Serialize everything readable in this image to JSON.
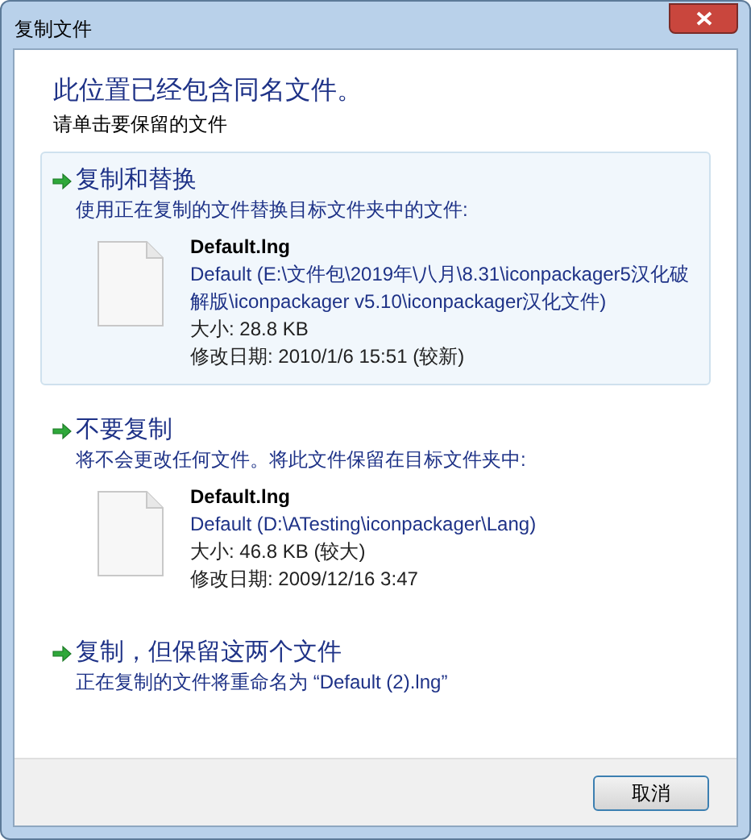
{
  "window": {
    "title": "复制文件"
  },
  "heading": "此位置已经包含同名文件。",
  "instruction": "请单击要保留的文件",
  "options": [
    {
      "title": "复制和替换",
      "description": "使用正在复制的文件替换目标文件夹中的文件:",
      "selected": true,
      "file": {
        "name": "Default.lng",
        "path": "Default (E:\\文件包\\2019年\\八月\\8.31\\iconpackager5汉化破解版\\iconpackager v5.10\\iconpackager汉化文件)",
        "size": "大小: 28.8 KB",
        "modified": "修改日期: 2010/1/6 15:51 (较新)"
      }
    },
    {
      "title": "不要复制",
      "description": "将不会更改任何文件。将此文件保留在目标文件夹中:",
      "selected": false,
      "file": {
        "name": "Default.lng",
        "path": "Default (D:\\ATesting\\iconpackager\\Lang)",
        "size": "大小: 46.8 KB (较大)",
        "modified": "修改日期: 2009/12/16 3:47"
      }
    },
    {
      "title": "复制，但保留这两个文件",
      "description": "正在复制的文件将重命名为 “Default (2).lng”",
      "selected": false
    }
  ],
  "buttons": [
    {
      "label": "取消"
    }
  ]
}
